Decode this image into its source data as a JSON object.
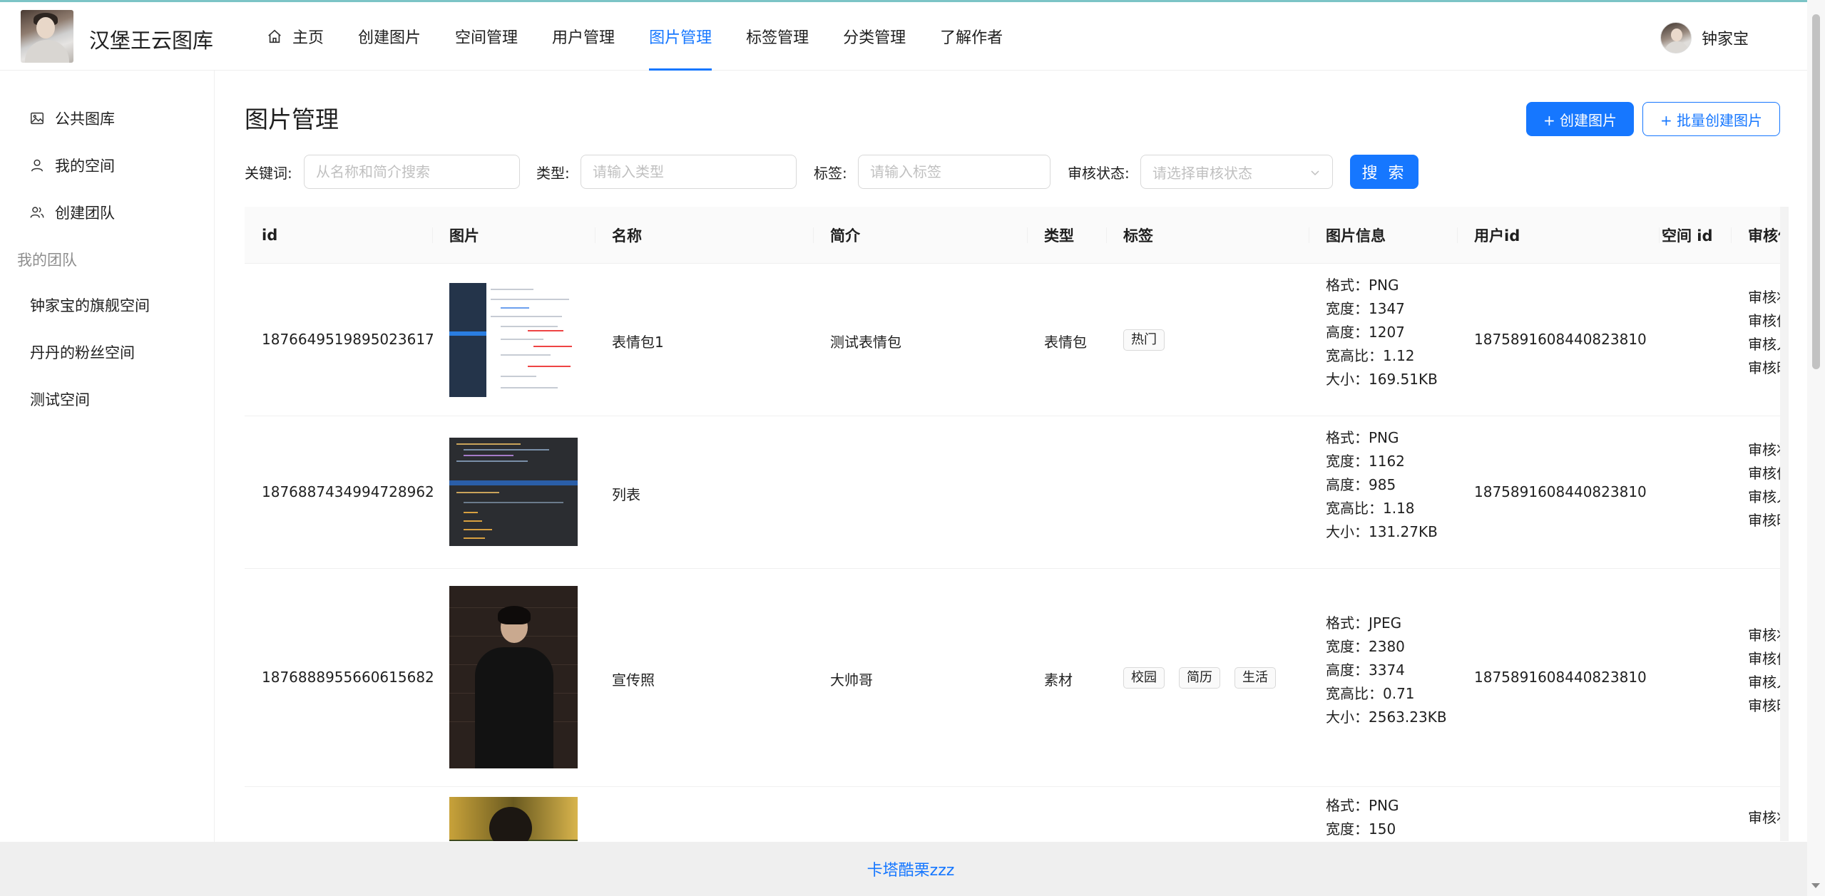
{
  "header": {
    "site_title": "汉堡王云图库",
    "nav": [
      {
        "label": "主页",
        "icon": "home-icon"
      },
      {
        "label": "创建图片"
      },
      {
        "label": "空间管理"
      },
      {
        "label": "用户管理"
      },
      {
        "label": "图片管理",
        "active": true
      },
      {
        "label": "标签管理"
      },
      {
        "label": "分类管理"
      },
      {
        "label": "了解作者"
      }
    ],
    "user_name": "钟家宝"
  },
  "sidebar": {
    "items": [
      {
        "label": "公共图库",
        "icon": "picture-icon"
      },
      {
        "label": "我的空间",
        "icon": "user-icon"
      },
      {
        "label": "创建团队",
        "icon": "team-icon"
      }
    ],
    "group_title": "我的团队",
    "teams": [
      "钟家宝的旗舰空间",
      "丹丹的粉丝空间",
      "测试空间"
    ]
  },
  "main": {
    "title": "图片管理",
    "create_button": "+ 创建图片",
    "batch_create_button": "+ 批量创建图片",
    "filters": {
      "keyword_label": "关键词:",
      "keyword_placeholder": "从名称和简介搜索",
      "category_label": "类型:",
      "category_placeholder": "请输入类型",
      "tags_label": "标签:",
      "tags_placeholder": "请输入标签",
      "review_label": "审核状态:",
      "review_placeholder": "请选择审核状态",
      "search_button": "搜 索"
    }
  },
  "table": {
    "columns": [
      "id",
      "图片",
      "名称",
      "简介",
      "类型",
      "标签",
      "图片信息",
      "用户id",
      "空间 id",
      "审核信息"
    ],
    "rows": [
      {
        "id": "1876649519895023617",
        "name": "表情包1",
        "intro": "测试表情包",
        "category": "表情包",
        "tags": [
          "热门"
        ],
        "info": [
          "格式：PNG",
          "宽度：1347",
          "高度：1207",
          "宽高比：1.12",
          "大小：169.51KB"
        ],
        "user_id": "1875891608440823810",
        "space_id": "",
        "audit": [
          "审核状",
          "审核信",
          "审核人",
          "审核时"
        ]
      },
      {
        "id": "1876887434994728962",
        "name": "列表",
        "intro": "",
        "category": "",
        "tags": [],
        "info": [
          "格式：PNG",
          "宽度：1162",
          "高度：985",
          "宽高比：1.18",
          "大小：131.27KB"
        ],
        "user_id": "1875891608440823810",
        "space_id": "",
        "audit": [
          "审核状",
          "审核信",
          "审核人",
          "审核时"
        ]
      },
      {
        "id": "1876888955660615682",
        "name": "宣传照",
        "intro": "大帅哥",
        "category": "素材",
        "tags": [
          "校园",
          "简历",
          "生活"
        ],
        "info": [
          "格式：JPEG",
          "宽度：2380",
          "高度：3374",
          "宽高比：0.71",
          "大小：2563.23KB"
        ],
        "user_id": "1875891608440823810",
        "space_id": "",
        "audit": [
          "审核状",
          "审核信",
          "审核人",
          "审核时"
        ]
      },
      {
        "id": "",
        "name": "",
        "intro": "",
        "category": "",
        "tags": [],
        "info": [
          "格式：PNG",
          "宽度：150"
        ],
        "user_id": "",
        "space_id": "",
        "audit": [
          "审核状"
        ]
      }
    ]
  },
  "footer": {
    "link": "卡塔酷栗zzz"
  },
  "colors": {
    "primary": "#1677ff",
    "accent_line": "#7cc4c6"
  }
}
